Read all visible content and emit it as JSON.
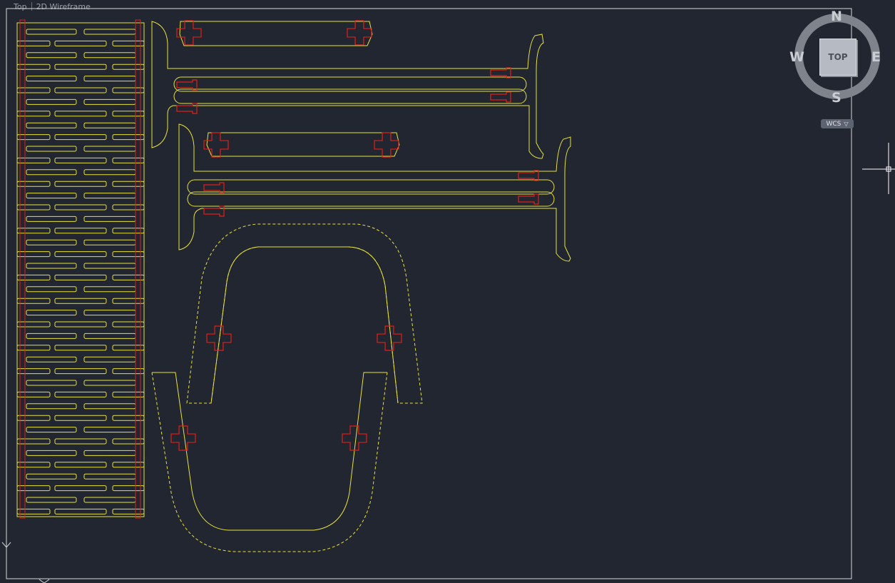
{
  "viewport": {
    "view_label": "Top",
    "style_label": "2D Wireframe"
  },
  "viewcube": {
    "north": "N",
    "south": "S",
    "east": "E",
    "west": "W",
    "face_label": "TOP",
    "wcs_label": "WCS"
  },
  "colors": {
    "background": "#212630",
    "outline_yellow": "#e8e23a",
    "connector_red": "#e0201a",
    "frame": "#d8d8d8",
    "compass_ring": "#7f838b"
  },
  "icons": [
    "crosshair-cursor-icon",
    "ucs-icon",
    "chevron-down-icon"
  ]
}
